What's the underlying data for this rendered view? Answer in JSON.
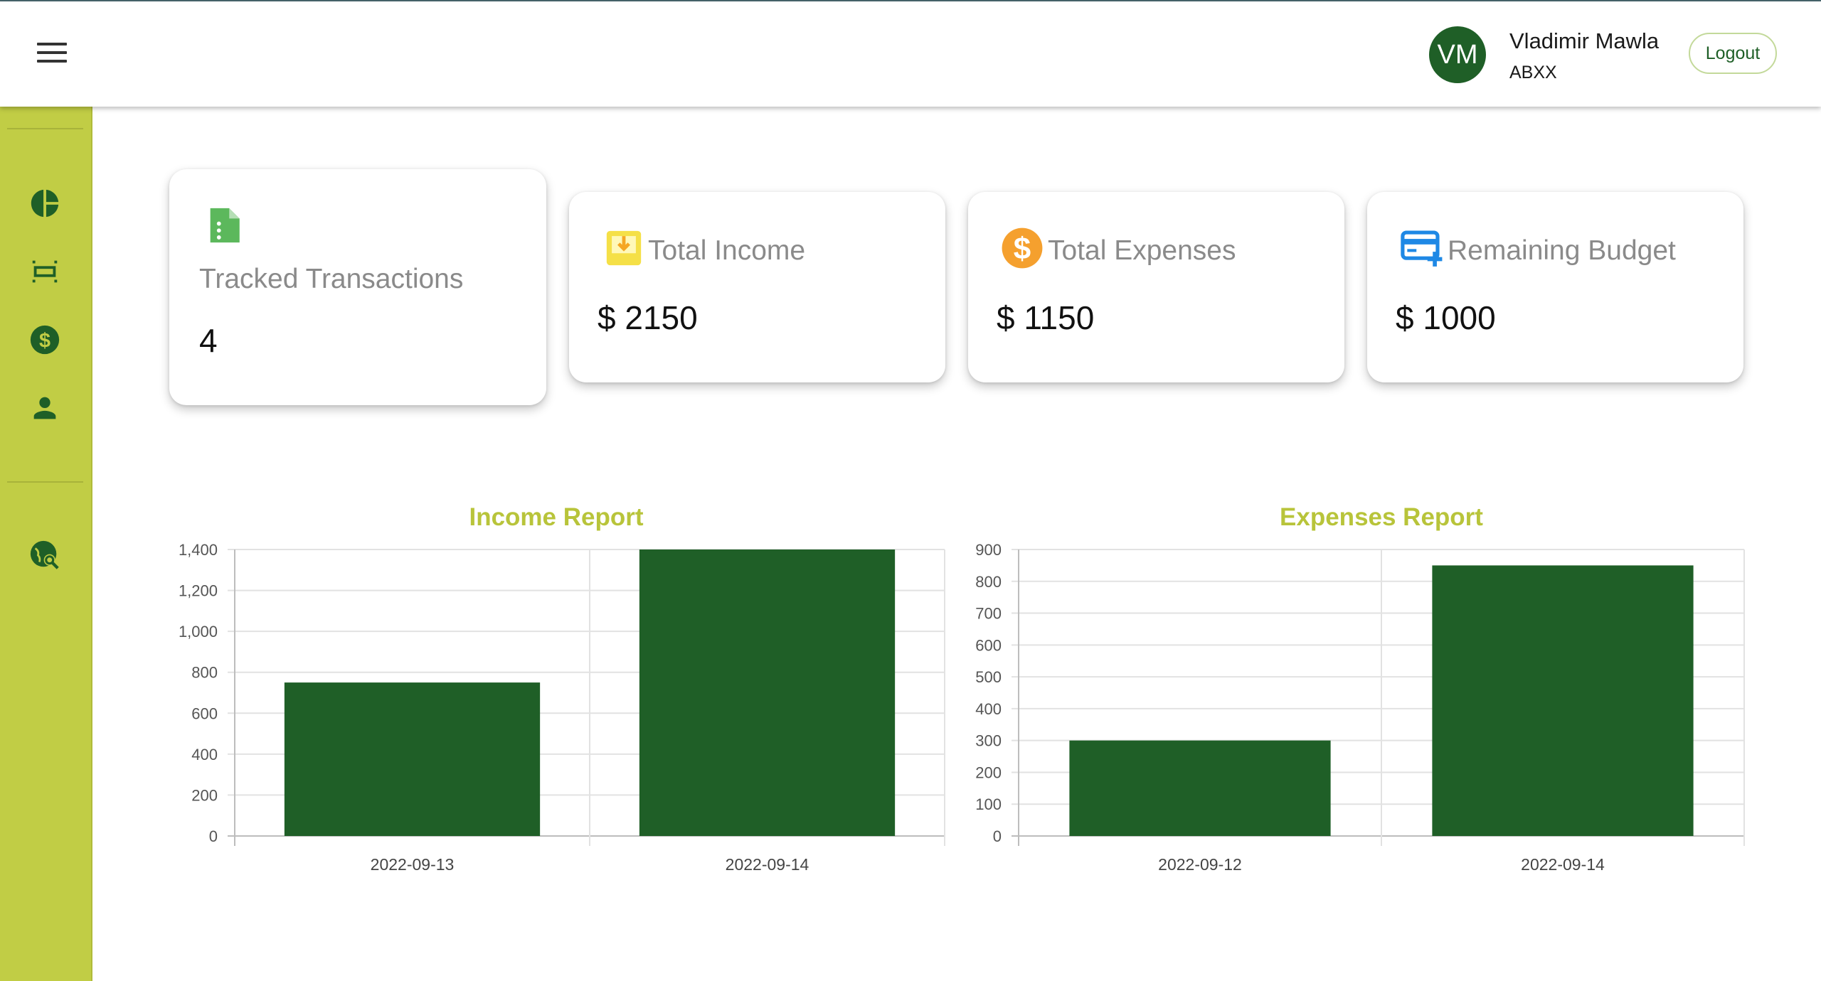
{
  "header": {
    "menu_icon": "menu-icon",
    "avatar_initials": "VM",
    "user_name": "Vladimir Mawla",
    "user_org": "ABXX",
    "logout_label": "Logout"
  },
  "sidebar": {
    "items": [
      {
        "icon": "pie-chart-icon"
      },
      {
        "icon": "settings-overscan-icon"
      },
      {
        "icon": "dollar-circle-icon"
      },
      {
        "icon": "person-icon"
      },
      {
        "icon": "travel-explore-icon"
      }
    ]
  },
  "cards": [
    {
      "label": "Tracked Transactions",
      "value": "4",
      "icon": "document-icon",
      "color": "#5cb85c"
    },
    {
      "label": "Total Income",
      "value": "$ 2150",
      "icon": "inbox-download-icon",
      "color": "#f5e047"
    },
    {
      "label": "Total Expenses",
      "value": "$ 1150",
      "icon": "dollar-coin-icon",
      "color": "#f5a02e"
    },
    {
      "label": "Remaining Budget",
      "value": "$ 1000",
      "icon": "add-card-icon",
      "color": "#1e88e5"
    }
  ],
  "colors": {
    "bar": "#1f5f27",
    "sidebar": "#c1cd45",
    "chart_title": "#b8c43a",
    "accent": "#1f5f27"
  },
  "chart_data": [
    {
      "type": "bar",
      "title": "Income Report",
      "categories": [
        "2022-09-13",
        "2022-09-14"
      ],
      "values": [
        750,
        1400
      ],
      "ylim": [
        0,
        1400
      ],
      "yticks": [
        0,
        200,
        400,
        600,
        800,
        1000,
        1200,
        1400
      ],
      "ytick_labels": [
        "0",
        "200",
        "400",
        "600",
        "800",
        "1,000",
        "1,200",
        "1,400"
      ],
      "grid": true
    },
    {
      "type": "bar",
      "title": "Expenses Report",
      "categories": [
        "2022-09-12",
        "2022-09-14"
      ],
      "values": [
        300,
        850
      ],
      "ylim": [
        0,
        900
      ],
      "yticks": [
        0,
        100,
        200,
        300,
        400,
        500,
        600,
        700,
        800,
        900
      ],
      "ytick_labels": [
        "0",
        "100",
        "200",
        "300",
        "400",
        "500",
        "600",
        "700",
        "800",
        "900"
      ],
      "grid": true
    }
  ]
}
